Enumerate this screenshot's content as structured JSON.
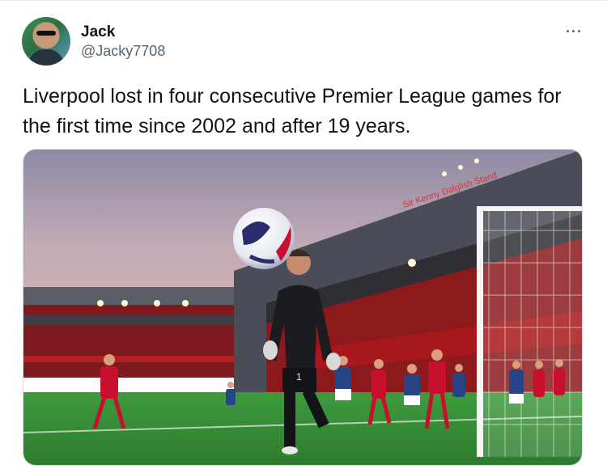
{
  "author": {
    "name": "Jack",
    "handle": "@Jacky7708"
  },
  "tweet": {
    "text": "Liverpool lost in four consecutive Premier League games for the first time since 2002 and after 19 years."
  },
  "more_menu": {
    "label": "···"
  },
  "media": {
    "banner_text": "Sir Kenny Dalglish Stand",
    "player_number": "1",
    "colors": {
      "sky": "#b6a6b6",
      "pitch": "#3c8f3a",
      "stand": "#9b1c1c",
      "kit_red": "#c8102e",
      "kit_blue": "#274488"
    }
  }
}
